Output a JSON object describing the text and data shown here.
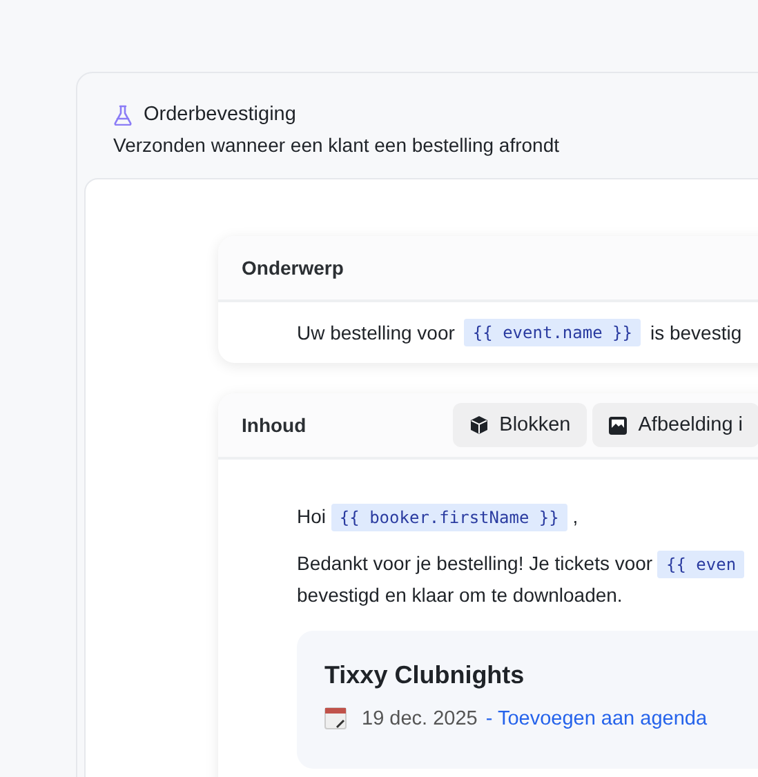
{
  "template": {
    "title": "Orderbevestiging",
    "description": "Verzonden wanneer een klant een bestelling afrondt"
  },
  "subject": {
    "label": "Onderwerp",
    "parts": [
      {
        "kind": "text",
        "text": "Uw bestelling voor"
      },
      {
        "kind": "variable",
        "text": "{{ event.name }}"
      },
      {
        "kind": "text",
        "text": "is bevestig"
      }
    ]
  },
  "content": {
    "label": "Inhoud",
    "buttons": [
      {
        "kind": "blocks",
        "label": "Blokken"
      },
      {
        "kind": "image",
        "label": "Afbeelding i"
      }
    ],
    "paragraphs": [
      {
        "parts": [
          {
            "kind": "text",
            "text": "Hoi"
          },
          {
            "kind": "variable",
            "text": "{{ booker.firstName }}"
          },
          {
            "kind": "text",
            "text": ","
          }
        ]
      },
      {
        "parts": [
          {
            "kind": "text",
            "text": "Bedankt voor je bestelling! Je tickets voor"
          },
          {
            "kind": "variable",
            "text": "{{ even"
          },
          {
            "kind": "text",
            "text": "bevestigd en klaar om te downloaden."
          }
        ]
      }
    ],
    "event": {
      "name": "Tixxy Clubnights",
      "date": "19 dec. 2025",
      "link": "- Toevoegen aan agenda"
    }
  }
}
